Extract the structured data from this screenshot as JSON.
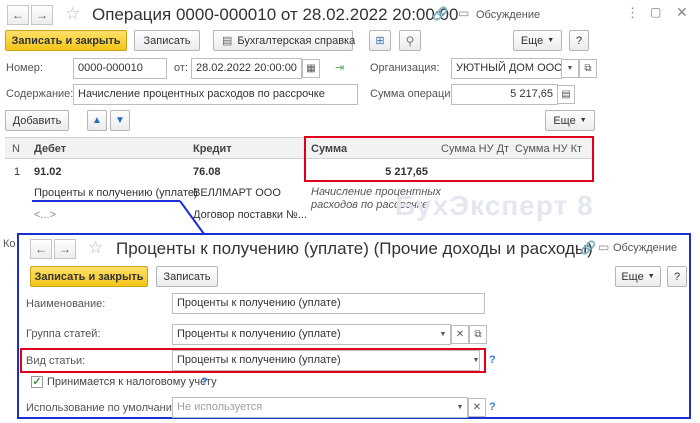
{
  "main_window": {
    "title": "Операция 0000-000010 от 28.02.2022 20:00:00",
    "discussion_label": "Обсуждение",
    "toolbar": {
      "save_close": "Записать и закрыть",
      "save": "Записать",
      "report": "Бухгалтерская справка",
      "more": "Еще",
      "help": "?"
    },
    "form": {
      "number_label": "Номер:",
      "number_value": "0000-000010",
      "date_label": "от:",
      "date_value": "28.02.2022 20:00:00",
      "org_label": "Организация:",
      "org_value": "УЮТНЫЙ ДОМ ООО",
      "content_label": "Содержание:",
      "content_value": "Начисление процентных расходов по рассрочке",
      "sum_label": "Сумма операции:",
      "sum_value": "5 217,65"
    },
    "table_toolbar": {
      "add": "Добавить",
      "more": "Еще"
    },
    "table": {
      "headers": {
        "n": "N",
        "debit": "Дебет",
        "credit": "Кредит",
        "sum": "Сумма",
        "sum_nu_dt": "Сумма НУ Дт",
        "sum_nu_kt": "Сумма НУ Кт"
      },
      "row": {
        "n": "1",
        "debit_account": "91.02",
        "credit_account": "76.08",
        "sum": "5 217,65",
        "debit_sub1": "Проценты к получению (уплате)",
        "debit_sub2": "<...>",
        "credit_sub1": "ВЕЛЛМАРТ ООО",
        "credit_sub2": "Договор поставки №...",
        "comment_line1": "Начисление процентных",
        "comment_line2": "расходов по рассрочке"
      },
      "left_cut": "Ко"
    },
    "watermark": "БухЭксперт 8"
  },
  "popup_window": {
    "title": "Проценты к получению (уплате) (Прочие доходы и расходы)",
    "discussion_label": "Обсуждение",
    "toolbar": {
      "save_close": "Записать и закрыть",
      "save": "Записать",
      "more": "Еще",
      "help": "?"
    },
    "form": {
      "name_label": "Наименование:",
      "name_value": "Проценты к получению (уплате)",
      "group_label": "Группа статей:",
      "group_value": "Проценты к получению (уплате)",
      "kind_label": "Вид статьи:",
      "kind_value": "Проценты к получению (уплате)",
      "tax_checkbox_label": "Принимается к налоговому учету",
      "default_label": "Использование по умолчанию:",
      "default_placeholder": "Не используется"
    }
  },
  "colors": {
    "highlight_red": "#e0001b",
    "highlight_blue": "#1a2fd6",
    "accent_yellow": "#f3c515",
    "link_blue": "#3a7bd5"
  }
}
